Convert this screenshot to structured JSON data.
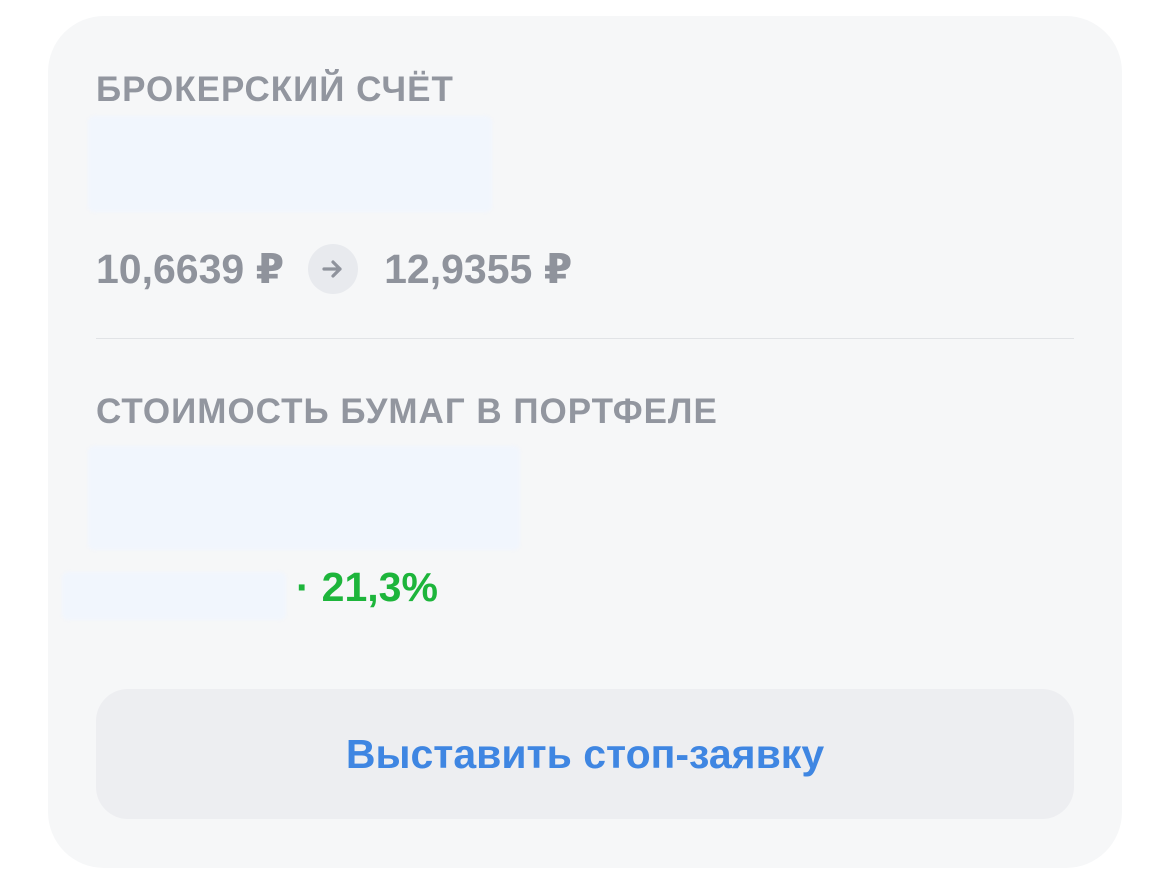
{
  "brokerage_account": {
    "label": "БРОКЕРСКИЙ СЧЁТ",
    "price_from": "10,6639 ₽",
    "price_to": "12,9355 ₽"
  },
  "portfolio": {
    "label": "СТОИМОСТЬ БУМАГ В ПОРТФЕЛЕ",
    "change_separator": "·",
    "change_percent": "21,3%"
  },
  "actions": {
    "stop_order_label": "Выставить стоп-заявку"
  },
  "icons": {
    "arrow": "arrow-right-icon"
  },
  "colors": {
    "label": "#92969f",
    "price": "#8f939c",
    "positive": "#1db53b",
    "accent": "#3f86e2",
    "card_bg": "#f6f7f8",
    "button_bg": "#edeef1"
  }
}
